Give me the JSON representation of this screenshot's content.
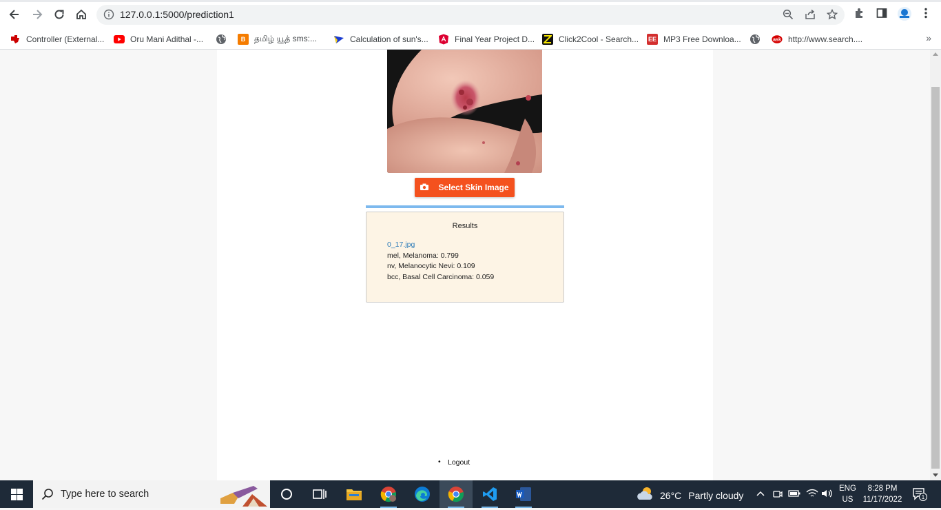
{
  "browser": {
    "url": "127.0.0.1:5000/prediction1",
    "bookmarks": [
      {
        "label": "Controller (External...",
        "icon": "ti-logo-icon",
        "color": "#cc0000"
      },
      {
        "label": "Oru Mani Adithal -...",
        "icon": "youtube-icon",
        "color": "#ff0000"
      },
      {
        "label": "",
        "icon": "globe-icon",
        "color": "#5f6368"
      },
      {
        "label": "தமிழ் யூத் sms:...",
        "icon": "blogger-icon",
        "color": "#f57c00"
      },
      {
        "label": "Calculation of sun's...",
        "icon": "bookmark-flag-icon",
        "color": "#1a3bd1"
      },
      {
        "label": "Final Year Project D...",
        "icon": "angular-icon",
        "color": "#dd0031"
      },
      {
        "label": "Click2Cool - Search...",
        "icon": "click2cool-icon",
        "color": "#111111"
      },
      {
        "label": "MP3 Free Downloa...",
        "icon": "mp3-icon",
        "color": "#d32f2f"
      },
      {
        "label": "",
        "icon": "globe-icon",
        "color": "#5f6368"
      },
      {
        "label": "http://www.search....",
        "icon": "ask-icon",
        "color": "#d50000"
      }
    ]
  },
  "page": {
    "select_button_label": "Select Skin Image",
    "results": {
      "title": "Results",
      "file": "0_17.jpg",
      "lines": [
        "mel, Melanoma: 0.799",
        "nv, Melanocytic Nevi: 0.109",
        "bcc, Basal Cell Carcinoma: 0.059"
      ]
    },
    "logout_label": "Logout"
  },
  "taskbar": {
    "search_placeholder": "Type here to search",
    "weather_temp": "26°C",
    "weather_condition": "Partly cloudy",
    "lang_top": "ENG",
    "lang_bottom": "US",
    "time": "8:28 PM",
    "date": "11/17/2022",
    "notification_count": "1"
  },
  "colors": {
    "accent_button": "#f4511e",
    "progress": "#7db9ee",
    "results_bg": "#fdf4e5",
    "taskbar_bg": "#1e2a38"
  }
}
